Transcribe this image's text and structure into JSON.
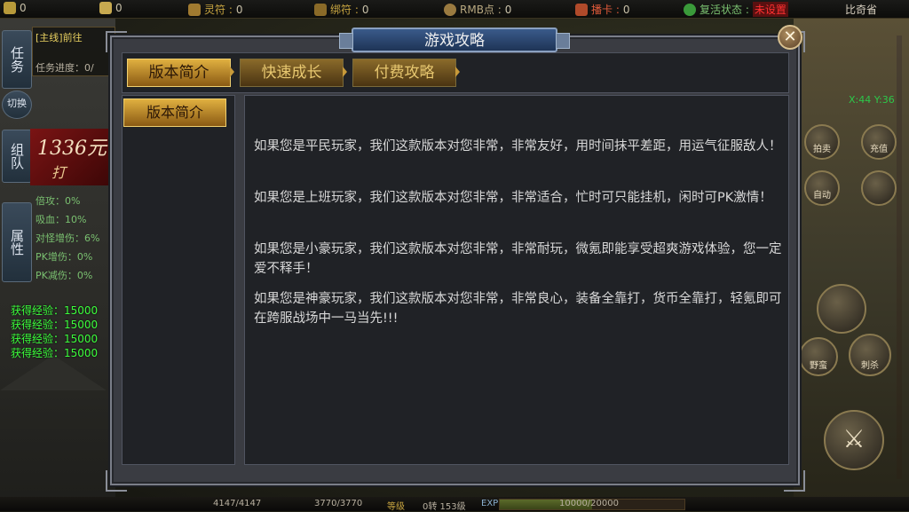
{
  "topbar": {
    "items": [
      {
        "label": "",
        "value": "0"
      },
      {
        "label": "",
        "value": "0"
      },
      {
        "label": "灵符 :",
        "value": "0"
      },
      {
        "label": "绑符 :",
        "value": "0"
      },
      {
        "label": "RMB点 :",
        "value": "0"
      },
      {
        "label": "播卡 :",
        "value": "0"
      },
      {
        "label": "复活状态 :",
        "value": "未设置"
      }
    ],
    "server": "比奇省"
  },
  "left_hud": {
    "task_tab": "任务",
    "switch_btn": "切换",
    "team_tab": "组队",
    "attr_tab": "属性",
    "quest_title": "[主线]前往",
    "quest_progress": "任务进度：0/",
    "promo_big": "1336元",
    "promo_small": "打",
    "attrs": [
      "倍攻：0%",
      "吸血：10%",
      "对怪增伤：6%",
      "PK增伤：0%",
      "PK减伤：0%"
    ],
    "exp_log": [
      "获得经验：15000",
      "获得经验：15000",
      "获得经验：15000",
      "获得经验：15000"
    ]
  },
  "right_hud": {
    "coords": "X:44  Y:36",
    "skills": [
      "拍卖",
      "充值",
      "自动",
      "野蛮",
      "刺杀",
      "攻击"
    ]
  },
  "bottombar": {
    "hp": "4147/4147",
    "mp": "3770/3770",
    "level_label": "等级",
    "level": "0转 153级",
    "exp_label": "EXP",
    "exp": "10000/20000",
    "exp_fraction": 0.5
  },
  "dialog": {
    "title": "游戏攻略",
    "close": "✕",
    "tabs": [
      "版本简介",
      "快速成长",
      "付费攻略"
    ],
    "active_tab": 0,
    "subtabs": [
      "版本简介"
    ],
    "paragraphs": [
      "如果您是平民玩家，我们这款版本对您非常，非常友好，用时间抹平差距，用运气征服敌人！",
      "如果您是上班玩家，我们这款版本对您非常，非常适合，忙时可只能挂机，闲时可PK激情！",
      "如果您是小豪玩家，我们这款版本对您非常，非常耐玩，微氪即能享受超爽游戏体验，您一定爱不释手！",
      "如果您是神豪玩家，我们这款版本对您非常，非常良心，装备全靠打，货币全靠打，轻氪即可在跨服战场中一马当先!!!"
    ]
  }
}
